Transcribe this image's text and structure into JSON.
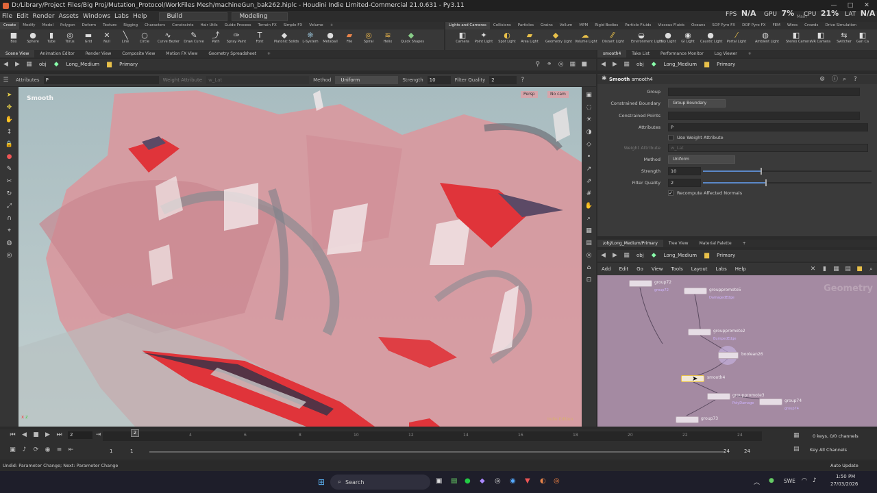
{
  "window": {
    "title": "D:/Library/Project Files/Big Proj/Mutation_Protocol/WorkFiles Mesh/machineGun_bak262.hiplc - Houdini Indie Limited-Commercial 21.0.631 - Py3.11",
    "min": "—",
    "max": "□",
    "close": "✕"
  },
  "menu": [
    "File",
    "Edit",
    "Render",
    "Assets",
    "Windows",
    "Labs",
    "Help"
  ],
  "desktop": {
    "build": "Build",
    "modeling": "Modeling"
  },
  "hud": {
    "fps_label": "FPS",
    "fps": "N/A",
    "gpu_label": "GPU",
    "gpu": "7%",
    "cpu_label": "CPU",
    "cpu": "21%",
    "lat_label": "LAT",
    "lat": "N/A",
    "main": "Main"
  },
  "shelf_tabs_left": [
    "Create",
    "Modify",
    "Model",
    "Polygon",
    "Deform",
    "Texture",
    "Rigging",
    "Characters",
    "Constraints",
    "Hair Utils",
    "Guide Process",
    "Terrain FX",
    "Simple FX",
    "Volume"
  ],
  "shelf_tabs_right": [
    "Lights and Cameras",
    "Collisions",
    "Particles",
    "Grains",
    "Vellum",
    "MPM",
    "Rigid Bodies",
    "Particle Fluids",
    "Viscous Fluids",
    "Oceans",
    "SOP Pyro FX",
    "DOP Pyro FX",
    "FEM",
    "Wires",
    "Crowds",
    "Drive Simulation"
  ],
  "shelf_tools_left": [
    "Box",
    "Sphere",
    "Tube",
    "Torus",
    "Grid",
    "Null",
    "Line",
    "Circle",
    "Curve Bezier",
    "Draw Curve",
    "Path",
    "Spray Paint",
    "Font",
    "Platonic Solids",
    "L-System",
    "Metaball",
    "File",
    "Spiral",
    "Helix",
    "Quick Shapes"
  ],
  "shelf_tools_right": [
    "Camera",
    "Point Light",
    "Spot Light",
    "Area Light",
    "Geometry Light",
    "Volume Light",
    "Distant Light",
    "Environment Light",
    "Sky Light",
    "GI Light",
    "Caustic Light",
    "Portal Light",
    "Ambient Light",
    "Stereo Camera",
    "VR Camera",
    "Switcher",
    "Gan Ca"
  ],
  "pane_tabs_left": [
    "Scene View",
    "Animation Editor",
    "Render View",
    "Composite View",
    "Motion FX View",
    "Geometry Spreadsheet"
  ],
  "pane_tabs_right": [
    "smooth4",
    "Take List",
    "Performance Monitor",
    "Log Viewer"
  ],
  "path": {
    "obj": "obj",
    "node": "Long_Medium",
    "geo": "Primary"
  },
  "toolbar": {
    "attributes_label": "Attributes",
    "attributes_value": "P",
    "weight_label": "Weight Attribute",
    "weight_value": "w_Lat",
    "method_label": "Method",
    "method_value": "Uniform",
    "strength_label": "Strength",
    "strength_value": "10",
    "filter_label": "Filter Quality",
    "filter_value": "2"
  },
  "viewport": {
    "tool": "Smooth",
    "persp": "Persp",
    "cam": "No cam",
    "watermark": "Indie Edition"
  },
  "params": {
    "node_type": "Smooth",
    "node_name": "smooth4",
    "group_label": "Group",
    "group_value": "",
    "boundary_label": "Constrained Boundary",
    "boundary_value": "Group Boundary",
    "points_label": "Constrained Points",
    "points_value": "",
    "attributes_label": "Attributes",
    "attributes_value": "P",
    "use_weight_label": "Use Weight Attribute",
    "weight_label": "Weight Attribute",
    "weight_value": "w_Lat",
    "method_label": "Method",
    "method_value": "Uniform",
    "strength_label": "Strength",
    "strength_value": "10",
    "strength_frac": 0.34,
    "filter_label": "Filter Quality",
    "filter_value": "2",
    "filter_frac": 0.37,
    "recompute_label": "Recompute Affected Normals"
  },
  "ng_tabs": [
    "/obj/Long_Medium/Primary",
    "Tree View",
    "Material Palette"
  ],
  "ng_menu": [
    "Add",
    "Edit",
    "Go",
    "View",
    "Tools",
    "Layout",
    "Labs",
    "Help"
  ],
  "ng_watermark": "Geometry",
  "nodes": [
    {
      "name": "group72",
      "sub": "group72"
    },
    {
      "name": "grouppromote5",
      "sub": "DamagedEdge"
    },
    {
      "name": "grouppromote2",
      "sub": "BumpedEdge"
    },
    {
      "name": "boolean26",
      "sub": ""
    },
    {
      "name": "smooth4",
      "sub": ""
    },
    {
      "name": "grouppromote3",
      "sub": "PolyDamage"
    },
    {
      "name": "group74",
      "sub": "group74"
    },
    {
      "name": "group73",
      "sub": ""
    }
  ],
  "timeline": {
    "frame": "2",
    "current": "2",
    "start": "1",
    "start2": "1",
    "end": "24",
    "end2": "24",
    "ticks": [
      "2",
      "4",
      "6",
      "8",
      "10",
      "12",
      "14",
      "16",
      "18",
      "20",
      "22",
      "24"
    ],
    "keys": "0 keys, 0/0 channels",
    "keyall": "Key All Channels",
    "autoupdate": "Auto Update"
  },
  "status": "Undid: Parameter Change; Next: Parameter Change",
  "taskbar": {
    "search": "Search",
    "lang": "SWE",
    "time": "1:50 PM",
    "date": "27/03/2026"
  }
}
